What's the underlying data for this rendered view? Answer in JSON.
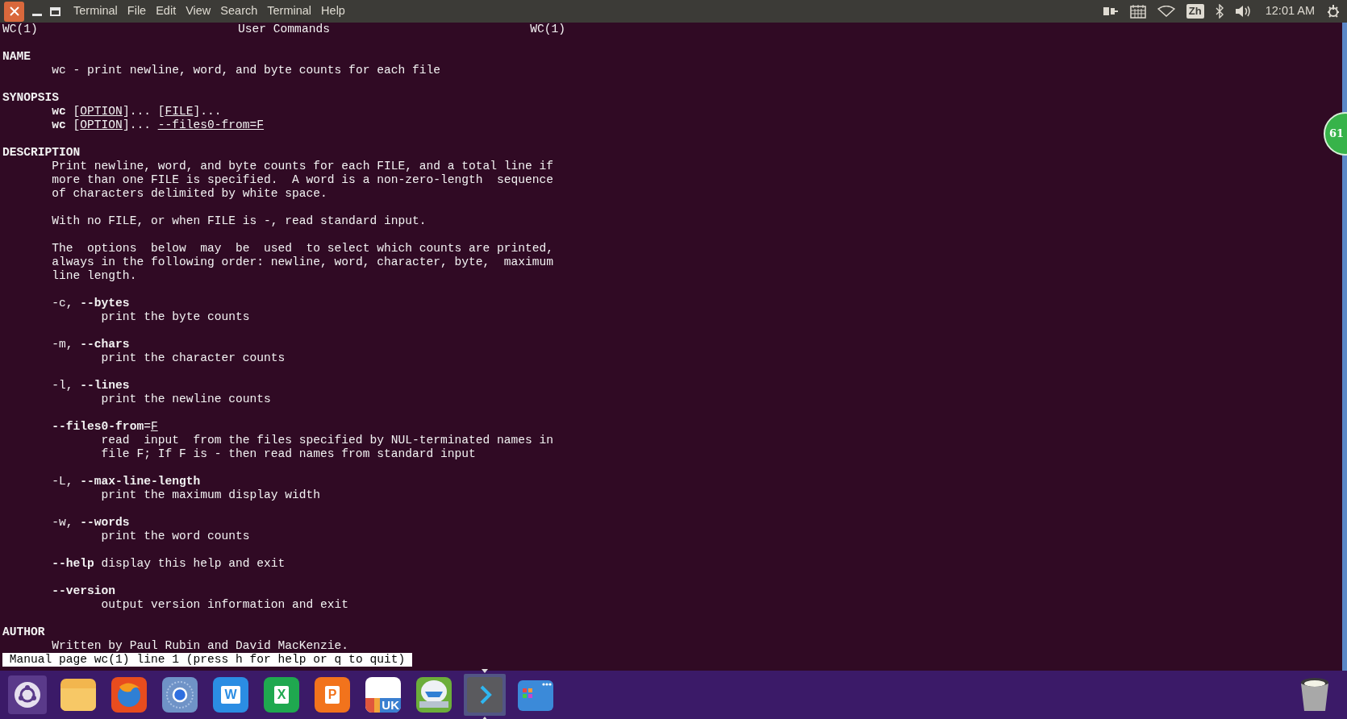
{
  "top_panel": {
    "menu": [
      "Terminal",
      "File",
      "Edit",
      "View",
      "Search",
      "Terminal",
      "Help"
    ],
    "input_method": "Zh",
    "clock": "12:01 AM"
  },
  "man_page": {
    "header": {
      "left": "WC(1)",
      "center": "User Commands",
      "right": "WC(1)"
    },
    "sections": [
      {
        "heading": "NAME",
        "blocks": [
          {
            "kind": "para",
            "lines": [
              [
                {
                  "text": "wc - print newline, word, and byte counts for each file",
                  "kind": "plain"
                }
              ]
            ]
          }
        ]
      },
      {
        "heading": "SYNOPSIS",
        "blocks": [
          {
            "kind": "para",
            "lines": [
              [
                {
                  "text": "wc",
                  "kind": "bold"
                },
                {
                  "text": " [",
                  "kind": "plain"
                },
                {
                  "text": "OPTION",
                  "kind": "underline"
                },
                {
                  "text": "]... [",
                  "kind": "plain"
                },
                {
                  "text": "FILE",
                  "kind": "underline"
                },
                {
                  "text": "]...",
                  "kind": "plain"
                }
              ],
              [
                {
                  "text": "wc",
                  "kind": "bold"
                },
                {
                  "text": " [",
                  "kind": "plain"
                },
                {
                  "text": "OPTION",
                  "kind": "underline"
                },
                {
                  "text": "]... ",
                  "kind": "plain"
                },
                {
                  "text": "--files0-from=F",
                  "kind": "underline"
                }
              ]
            ]
          }
        ]
      },
      {
        "heading": "DESCRIPTION",
        "blocks": [
          {
            "kind": "para",
            "lines": [
              [
                {
                  "text": "Print newline, word, and byte counts for each FILE, and a total line if",
                  "kind": "plain"
                }
              ],
              [
                {
                  "text": "more than one FILE is specified.  A word is a non-zero-length  sequence",
                  "kind": "plain"
                }
              ],
              [
                {
                  "text": "of characters delimited by white space.",
                  "kind": "plain"
                }
              ]
            ]
          },
          {
            "kind": "para",
            "lines": [
              [
                {
                  "text": "With no FILE, or when FILE is -, read standard input.",
                  "kind": "plain"
                }
              ]
            ]
          },
          {
            "kind": "para",
            "lines": [
              [
                {
                  "text": "The  options  below  may  be  used  to select which counts are printed,",
                  "kind": "plain"
                }
              ],
              [
                {
                  "text": "always in the following order: newline, word, character, byte,  maximum",
                  "kind": "plain"
                }
              ],
              [
                {
                  "text": "line length.",
                  "kind": "plain"
                }
              ]
            ]
          },
          {
            "kind": "option",
            "term": [
              {
                "text": "-c, ",
                "kind": "plain"
              },
              {
                "text": "--bytes",
                "kind": "bold"
              }
            ],
            "lines": [
              [
                {
                  "text": "print the byte counts",
                  "kind": "plain"
                }
              ]
            ]
          },
          {
            "kind": "option",
            "term": [
              {
                "text": "-m, ",
                "kind": "plain"
              },
              {
                "text": "--chars",
                "kind": "bold"
              }
            ],
            "lines": [
              [
                {
                  "text": "print the character counts",
                  "kind": "plain"
                }
              ]
            ]
          },
          {
            "kind": "option",
            "term": [
              {
                "text": "-l, ",
                "kind": "plain"
              },
              {
                "text": "--lines",
                "kind": "bold"
              }
            ],
            "lines": [
              [
                {
                  "text": "print the newline counts",
                  "kind": "plain"
                }
              ]
            ]
          },
          {
            "kind": "option",
            "term": [
              {
                "text": "--files0-from",
                "kind": "bold"
              },
              {
                "text": "=",
                "kind": "plain"
              },
              {
                "text": "F",
                "kind": "underline"
              }
            ],
            "lines": [
              [
                {
                  "text": "read  input  from the files specified by NUL-terminated names in",
                  "kind": "plain"
                }
              ],
              [
                {
                  "text": "file F; If F is - then read names from standard input",
                  "kind": "plain"
                }
              ]
            ]
          },
          {
            "kind": "option",
            "term": [
              {
                "text": "-L, ",
                "kind": "plain"
              },
              {
                "text": "--max-line-length",
                "kind": "bold"
              }
            ],
            "lines": [
              [
                {
                  "text": "print the maximum display width",
                  "kind": "plain"
                }
              ]
            ]
          },
          {
            "kind": "option",
            "term": [
              {
                "text": "-w, ",
                "kind": "plain"
              },
              {
                "text": "--words",
                "kind": "bold"
              }
            ],
            "lines": [
              [
                {
                  "text": "print the word counts",
                  "kind": "plain"
                }
              ]
            ]
          },
          {
            "kind": "inline_option",
            "term": [
              {
                "text": "--help",
                "kind": "bold"
              },
              {
                "text": " display this help and exit",
                "kind": "plain"
              }
            ]
          },
          {
            "kind": "option",
            "term": [
              {
                "text": "--version",
                "kind": "bold"
              }
            ],
            "lines": [
              [
                {
                  "text": "output version information and exit",
                  "kind": "plain"
                }
              ]
            ]
          }
        ]
      },
      {
        "heading": "AUTHOR",
        "blocks": [
          {
            "kind": "para",
            "lines": [
              [
                {
                  "text": "Written by Paul Rubin and David MacKenzie.",
                  "kind": "plain"
                }
              ]
            ]
          }
        ]
      }
    ],
    "status": "Manual page wc(1) line 1 (press h for help or q to quit)"
  },
  "badge": {
    "text": "61"
  },
  "dock": [
    {
      "kind": "dash",
      "active": false
    },
    {
      "kind": "folder",
      "active": false
    },
    {
      "kind": "browser",
      "active": false
    },
    {
      "kind": "chrome",
      "active": false
    },
    {
      "kind": "letter",
      "glyph": "W",
      "color": "#2b8de3",
      "active": false
    },
    {
      "kind": "letter",
      "glyph": "X",
      "color": "#1fa84f",
      "active": false
    },
    {
      "kind": "letter",
      "glyph": "P",
      "color": "#f2731c",
      "active": false
    },
    {
      "kind": "store",
      "glyph": "UK",
      "active": false
    },
    {
      "kind": "cloud",
      "active": false
    },
    {
      "kind": "terminal",
      "active": true
    },
    {
      "kind": "apps",
      "active": false
    }
  ]
}
